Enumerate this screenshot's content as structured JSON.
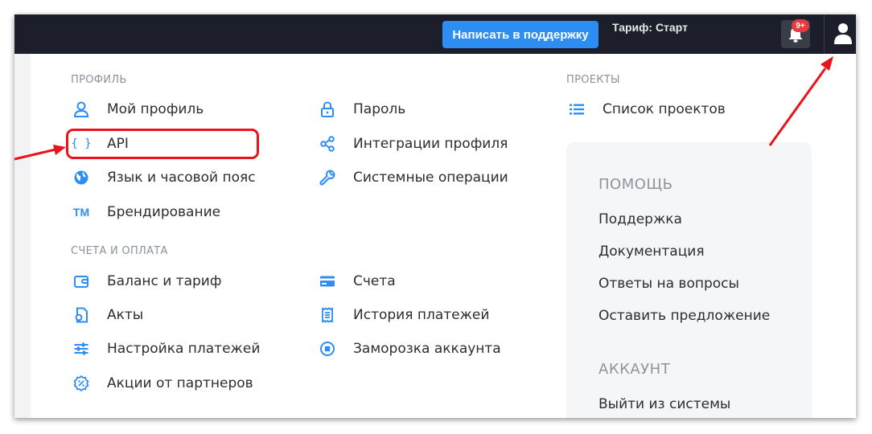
{
  "topbar": {
    "support_button": "Написать в поддержку",
    "tariff": "Тариф: Старт",
    "notifications_badge": "9+"
  },
  "menu": {
    "profile": {
      "title": "ПРОФИЛЬ",
      "items": [
        {
          "label": "Мой профиль",
          "icon": "user-icon"
        },
        {
          "label": "Пароль",
          "icon": "lock-icon"
        },
        {
          "label": "API",
          "icon": "code-braces-icon"
        },
        {
          "label": "Интеграции профиля",
          "icon": "share-icon"
        },
        {
          "label": "Язык и часовой пояс",
          "icon": "globe-icon"
        },
        {
          "label": "Системные операции",
          "icon": "wrench-icon"
        },
        {
          "label": "Брендирование",
          "icon": "trademark-icon"
        }
      ]
    },
    "billing": {
      "title": "СЧЕТА И ОПЛАТА",
      "items": [
        {
          "label": "Баланс и тариф",
          "icon": "wallet-icon"
        },
        {
          "label": "Счета",
          "icon": "credit-card-icon"
        },
        {
          "label": "Акты",
          "icon": "document-icon"
        },
        {
          "label": "История платежей",
          "icon": "receipt-icon"
        },
        {
          "label": "Настройка платежей",
          "icon": "sliders-icon"
        },
        {
          "label": "Заморозка аккаунта",
          "icon": "stop-circle-icon"
        },
        {
          "label": "Акции от партнеров",
          "icon": "discount-badge-icon"
        }
      ]
    },
    "projects": {
      "title": "ПРОЕКТЫ",
      "items": [
        {
          "label": "Список проектов",
          "icon": "list-icon"
        }
      ]
    },
    "help": {
      "title": "ПОМОЩЬ",
      "items": [
        "Поддержка",
        "Документация",
        "Ответы на вопросы",
        "Оставить предложение"
      ]
    },
    "account": {
      "title": "АККАУНТ",
      "items": [
        "Выйти из системы"
      ]
    }
  },
  "colors": {
    "accent": "#2e8df2",
    "topbar": "#1c1f2b",
    "annotation": "#e8141b"
  }
}
